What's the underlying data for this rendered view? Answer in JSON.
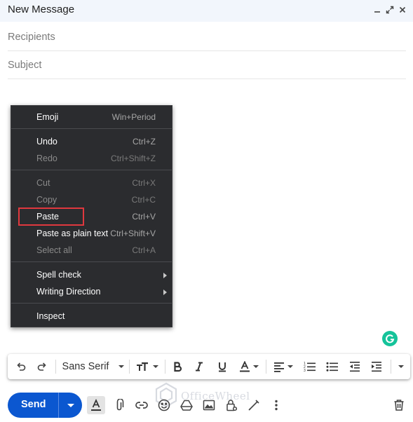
{
  "window": {
    "title": "New Message",
    "controls": [
      "minimize-icon",
      "expand-icon",
      "close-icon"
    ]
  },
  "compose": {
    "recipients_placeholder": "Recipients",
    "subject_placeholder": "Subject"
  },
  "context_menu": {
    "items": [
      {
        "label": "Emoji",
        "shortcut": "Win+Period",
        "enabled": true
      },
      {
        "label": "Undo",
        "shortcut": "Ctrl+Z",
        "enabled": true
      },
      {
        "label": "Redo",
        "shortcut": "Ctrl+Shift+Z",
        "enabled": false
      },
      {
        "label": "Cut",
        "shortcut": "Ctrl+X",
        "enabled": false
      },
      {
        "label": "Copy",
        "shortcut": "Ctrl+C",
        "enabled": false
      },
      {
        "label": "Paste",
        "shortcut": "Ctrl+V",
        "enabled": true,
        "highlighted": true
      },
      {
        "label": "Paste as plain text",
        "shortcut": "Ctrl+Shift+V",
        "enabled": true
      },
      {
        "label": "Select all",
        "shortcut": "Ctrl+A",
        "enabled": false
      },
      {
        "label": "Spell check",
        "shortcut": "",
        "enabled": true,
        "submenu": true
      },
      {
        "label": "Writing Direction",
        "shortcut": "",
        "enabled": true,
        "submenu": true
      },
      {
        "label": "Inspect",
        "shortcut": "",
        "enabled": true
      }
    ],
    "highlight_color": "#e0383e"
  },
  "formatting": {
    "font_family": "Sans Serif",
    "buttons": [
      "undo-icon",
      "redo-icon",
      "font-size-icon",
      "bold-icon",
      "italic-icon",
      "underline-icon",
      "text-color-icon",
      "align-icon",
      "numbered-list-icon",
      "bulleted-list-icon",
      "indent-less-icon",
      "indent-more-icon",
      "more-formatting-icon"
    ]
  },
  "bottom_toolbar": {
    "send_label": "Send",
    "icons": [
      "formatting-options-icon",
      "attach-icon",
      "link-icon",
      "emoji-icon",
      "drive-icon",
      "photo-icon",
      "confidential-icon",
      "signature-icon",
      "more-options-icon",
      "trash-icon"
    ]
  },
  "watermark": {
    "text": "OfficeWheel"
  },
  "colors": {
    "send_blue": "#0b57d0",
    "header_bg": "#f2f6fc",
    "menu_bg": "#2b2c2f",
    "grammarly_green": "#15c39a"
  }
}
